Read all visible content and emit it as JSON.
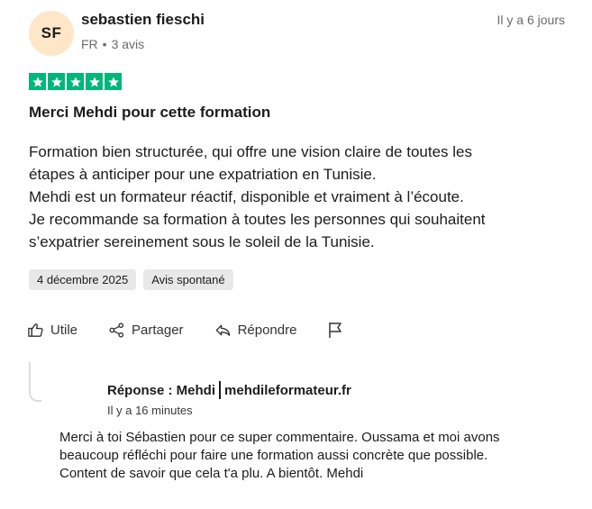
{
  "author": {
    "initials": "SF",
    "name": "sebastien fieschi",
    "country": "FR",
    "separator": "•",
    "review_count": "3 avis"
  },
  "date_ago": "Il y a 6 jours",
  "rating": {
    "value": 5,
    "max": 5,
    "color": "#00b67a"
  },
  "review": {
    "title": "Merci Mehdi pour cette formation",
    "lines": [
      "Formation bien structurée, qui offre une vision claire de toutes les",
      "étapes à anticiper pour une expatriation en Tunisie.",
      "Mehdi est un formateur réactif, disponible et vraiment à l’écoute.",
      "Je recommande sa formation à toutes les personnes qui souhaitent",
      "s’expatrier sereinement sous le soleil de la Tunisie."
    ]
  },
  "tags": [
    "4 décembre 2025",
    "Avis spontané"
  ],
  "actions": {
    "useful": "Utile",
    "share": "Partager",
    "reply": "Répondre",
    "icons": [
      "thumbs-up-icon",
      "share-icon",
      "reply-icon",
      "flag-icon"
    ]
  },
  "reply": {
    "label": "Réponse : Mehdi",
    "site": "mehdileformateur.fr",
    "time": "Il y a 16 minutes",
    "lines": [
      "Merci à toi Sébastien pour ce super commentaire. Oussama et moi avons",
      "beaucoup réfléchi pour faire une formation aussi concrète que possible.",
      "Content de savoir que cela t'a plu. A bientôt. Mehdi"
    ]
  }
}
